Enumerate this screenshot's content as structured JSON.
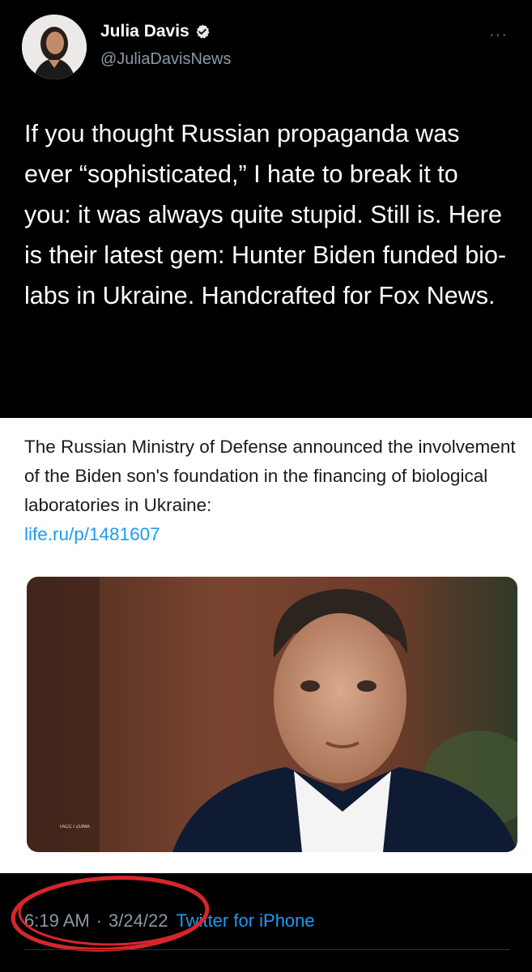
{
  "author": {
    "display_name": "Julia Davis",
    "handle": "@JuliaDavisNews",
    "verified": true,
    "avatar_icon": "profile-photo"
  },
  "more_options_label": "···",
  "tweet": {
    "text": "If you thought Russian propaganda was ever “sophisticated,” I hate to break it to you: it was always quite stupid. Still is. Here is their latest gem: Hunter Biden funded bio-labs in Ukraine. Handcrafted for Fox News."
  },
  "embedded_post": {
    "text": "The Russian Ministry of Defense announced the involvement of the Biden son's foundation in the financing of biological laboratories in Ukraine:",
    "link": "life.ru/p/1481607",
    "photo_credit": "TACC / ZUMA"
  },
  "meta": {
    "time": "6:19 AM",
    "separator": "·",
    "date": "3/24/22",
    "source": "Twitter for iPhone"
  },
  "colors": {
    "background": "#000000",
    "link_blue": "#1d9bf0",
    "secondary_text": "#8b98a5",
    "annotation_red": "#d6262b"
  }
}
